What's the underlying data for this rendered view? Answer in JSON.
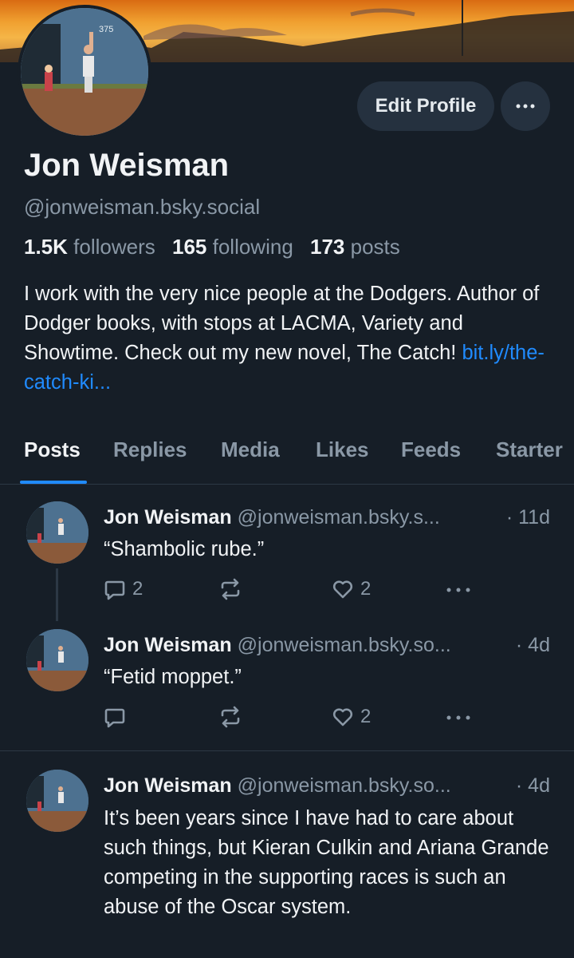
{
  "profile": {
    "display_name": "Jon Weisman",
    "handle": "@jonweisman.bsky.social",
    "edit_label": "Edit Profile",
    "more_icon": "ellipsis-icon",
    "followers_count": "1.5K",
    "followers_label": "followers",
    "following_count": "165",
    "following_label": "following",
    "posts_count": "173",
    "posts_label": "posts",
    "bio_text": "I work with the very nice people at the Dodgers. Author of Dodger books, with stops at LACMA, Variety and Showtime. Check out my new novel, The Catch! ",
    "bio_link": "bit.ly/the-catch-ki..."
  },
  "tabs": [
    "Posts",
    "Replies",
    "Media",
    "Likes",
    "Feeds",
    "Starter"
  ],
  "posts": [
    {
      "author": "Jon Weisman",
      "handle": "@jonweisman.bsky.s...",
      "time": "· 11d",
      "text": "“Shambolic rube.”",
      "replies": "2",
      "likes": "2"
    },
    {
      "author": "Jon Weisman",
      "handle": "@jonweisman.bsky.so...",
      "time": "· 4d",
      "text": "“Fetid moppet.”",
      "replies": "",
      "likes": "2"
    },
    {
      "author": "Jon Weisman",
      "handle": "@jonweisman.bsky.so...",
      "time": "· 4d",
      "text": "It’s been years since I have had to care about such things, but Kieran Culkin and Ariana Grande competing in the supporting races is such an abuse of the Oscar system."
    }
  ],
  "colors": {
    "background": "#161e27",
    "accent": "#208bfe",
    "muted": "#8a98a6"
  },
  "avatar_sign_text": "375"
}
